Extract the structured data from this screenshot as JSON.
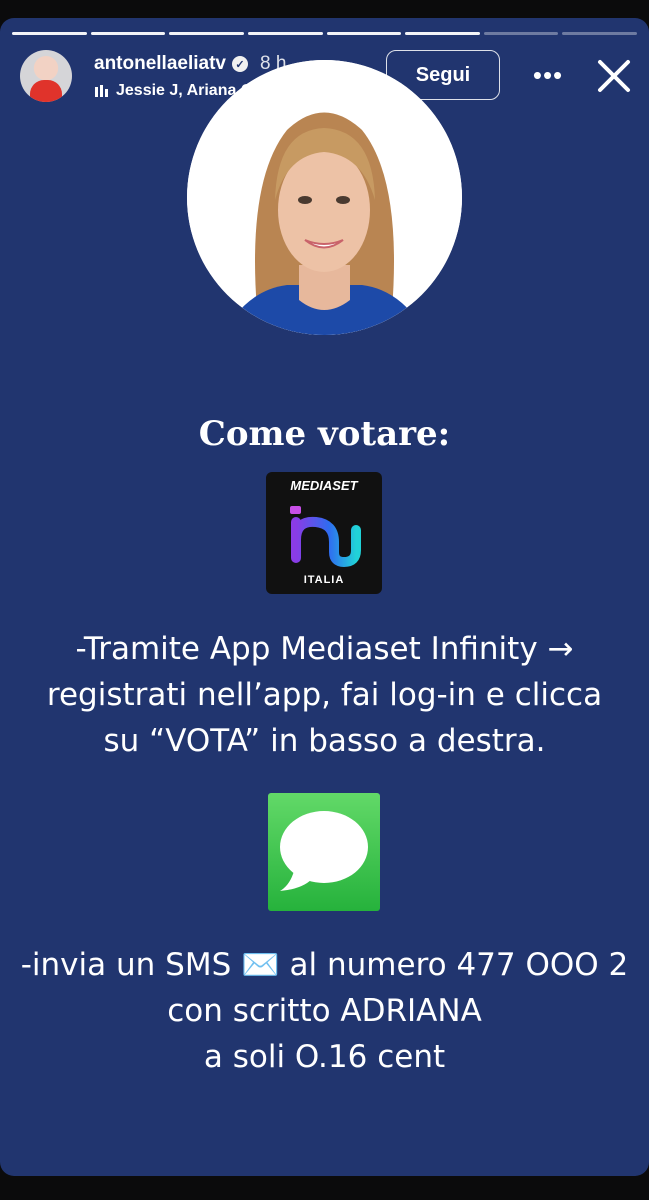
{
  "story": {
    "progress": {
      "segments_total": 8,
      "segments_viewed": 6
    }
  },
  "header": {
    "username": "antonellaeliatv",
    "verified_icon": "verified-badge-icon",
    "time_ago": "8 h",
    "music_text": "Jessie J, Ariana Gra...",
    "follow_label": "Segui",
    "more_label": "•••",
    "close_icon": "close-icon"
  },
  "content": {
    "title": "Come votare:",
    "app_icon": {
      "brand": "MEDIASET",
      "sub": "ITALIA"
    },
    "instruction_app": [
      "-Tramite App Mediaset Infinity →",
      "registrati nell’app, fai log-in e clicca",
      "su “VOTA” in basso a destra."
    ],
    "instruction_sms": [
      "-invia un SMS ✉️ al numero 477 OOO 2",
      "con scritto ADRIANA",
      "a soli O.16 cent"
    ]
  },
  "colors": {
    "background": "#21356f",
    "messages_green": "#3fc94f"
  }
}
